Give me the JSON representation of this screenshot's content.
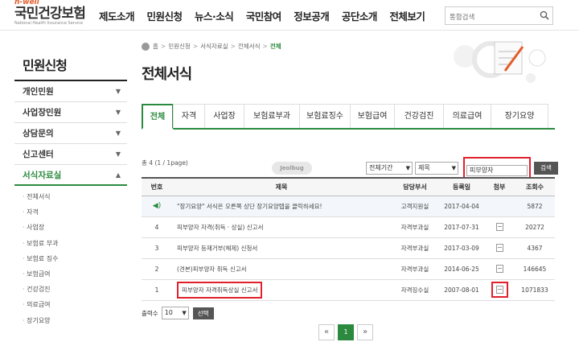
{
  "logo": {
    "tagline": "h-well",
    "name": "국민건강보험",
    "sub": "National Health Insurance Service"
  },
  "gnb": [
    "제도소개",
    "민원신청",
    "뉴스·소식",
    "국민참여",
    "정보공개",
    "공단소개",
    "전체보기"
  ],
  "search": {
    "placeholder": "통합검색"
  },
  "sidebar": {
    "title": "민원신청",
    "items": [
      {
        "label": "개인민원",
        "chevron": "▼"
      },
      {
        "label": "사업장민원",
        "chevron": "▼"
      },
      {
        "label": "상담문의",
        "chevron": "▼"
      },
      {
        "label": "신고센터",
        "chevron": "▼"
      },
      {
        "label": "서식자료실",
        "chevron": "▲"
      }
    ],
    "subitems": [
      "전체서식",
      "자격",
      "사업장",
      "보험료 부과",
      "보험료 징수",
      "보험급여",
      "건강검진",
      "의료급여",
      "장기요양"
    ]
  },
  "breadcrumb": [
    "홈",
    "민원신청",
    "서식자료실",
    "전체서식",
    "전체"
  ],
  "page_title": "전체서식",
  "tabs": [
    "전체",
    "자격",
    "사업장",
    "보험료부과",
    "보험료징수",
    "보험급여",
    "건강검진",
    "의료급여",
    "장기요양"
  ],
  "total": "총 4 (1 / 1page)",
  "filters": {
    "period": "전체기간",
    "field": "제목",
    "keyword": "피부양자",
    "search_button": "검색"
  },
  "stamp": "Jeolbug",
  "table": {
    "headers": [
      "번호",
      "제목",
      "담당부서",
      "등록일",
      "첨부",
      "조회수"
    ],
    "rows": [
      {
        "no": "",
        "subject": "\"장기요양\" 서식은 오른쪽 상단 장기요양탭을 클릭하세요!",
        "dept": "고객지원실",
        "date": "2017-04-04",
        "views": "5872",
        "notice": true
      },
      {
        "no": "4",
        "subject": "피부양자 자격(취득 · 상실) 신고서",
        "dept": "자격부과실",
        "date": "2017-07-31",
        "views": "20272"
      },
      {
        "no": "3",
        "subject": "피부양자 등재거부(해제) 신청서",
        "dept": "자격부과실",
        "date": "2017-03-09",
        "views": "4367"
      },
      {
        "no": "2",
        "subject": "(견본)피부양자 취득 신고서",
        "dept": "자격부과실",
        "date": "2014-06-25",
        "views": "146645"
      },
      {
        "no": "1",
        "subject": "피부양자 자격취득상실 신고서",
        "dept": "자격징수실",
        "date": "2007-08-01",
        "views": "1071833"
      }
    ]
  },
  "per_page": {
    "label": "출력수",
    "value": "10",
    "button": "선택"
  },
  "pager": {
    "prev": "«",
    "current": "1",
    "next": "»"
  },
  "icons": {
    "notice": "speaker-icon",
    "attachment": "file-icon",
    "search": "search-icon"
  },
  "colors": {
    "accent": "#2b8a3e",
    "highlight": "#e0202b"
  }
}
